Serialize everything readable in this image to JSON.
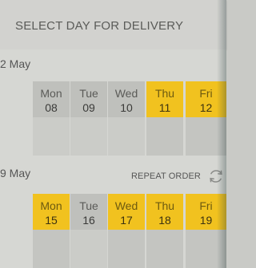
{
  "header": {
    "title": "SELECT DAY FOR DELIVERY"
  },
  "weeks": [
    {
      "label": "2 May",
      "days": [
        {
          "name": "Mon",
          "date": "08",
          "selected": false
        },
        {
          "name": "Tue",
          "date": "09",
          "selected": false
        },
        {
          "name": "Wed",
          "date": "10",
          "selected": false
        },
        {
          "name": "Thu",
          "date": "11",
          "selected": true
        },
        {
          "name": "Fri",
          "date": "12",
          "selected": true
        }
      ]
    },
    {
      "label": "9 May",
      "repeat_label": "REPEAT ORDER",
      "days": [
        {
          "name": "Mon",
          "date": "15",
          "selected": true
        },
        {
          "name": "Tue",
          "date": "16",
          "selected": false
        },
        {
          "name": "Wed",
          "date": "17",
          "selected": true
        },
        {
          "name": "Thu",
          "date": "18",
          "selected": true
        },
        {
          "name": "Fri",
          "date": "19",
          "selected": true
        }
      ]
    }
  ],
  "colors": {
    "selected": "#f1c21f",
    "unselected": "#bfc0bc",
    "background": "#d6d7d3"
  },
  "icons": {
    "repeat": "refresh-icon"
  }
}
